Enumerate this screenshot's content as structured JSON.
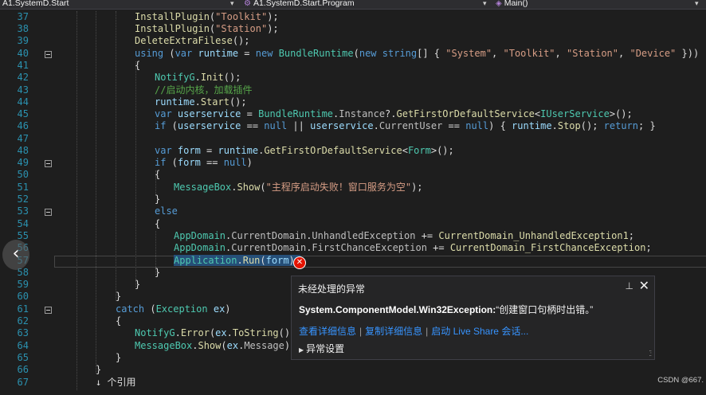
{
  "nav": {
    "project": "A1.SystemD.Start",
    "class": "A1.SystemD.Start.Program",
    "member": "Main()"
  },
  "gutter": [
    "37",
    "38",
    "39",
    "40",
    "41",
    "42",
    "43",
    "44",
    "45",
    "46",
    "47",
    "48",
    "49",
    "50",
    "51",
    "52",
    "53",
    "54",
    "55",
    "56",
    "57",
    "58",
    "59",
    "60",
    "61",
    "62",
    "63",
    "64",
    "65",
    "66",
    "67"
  ],
  "code": {
    "l37": [
      [
        "mt",
        "InstallPlugin"
      ],
      [
        "pl",
        "("
      ],
      [
        "st",
        "\"Toolkit\""
      ],
      [
        "pl",
        ");"
      ]
    ],
    "l38": [
      [
        "mt",
        "InstallPlugin"
      ],
      [
        "pl",
        "("
      ],
      [
        "st",
        "\"Station\""
      ],
      [
        "pl",
        ");"
      ]
    ],
    "l39": [
      [
        "mt",
        "DeleteExtraFilese"
      ],
      [
        "pl",
        "();"
      ]
    ],
    "l40": [
      [
        "kw",
        "using"
      ],
      [
        "pl",
        " ("
      ],
      [
        "kw",
        "var"
      ],
      [
        "pl",
        " "
      ],
      [
        "id",
        "runtime"
      ],
      [
        "pl",
        " = "
      ],
      [
        "kw",
        "new"
      ],
      [
        "pl",
        " "
      ],
      [
        "ty",
        "BundleRuntime"
      ],
      [
        "pl",
        "("
      ],
      [
        "kw",
        "new"
      ],
      [
        "pl",
        " "
      ],
      [
        "kw",
        "string"
      ],
      [
        "pl",
        "[] { "
      ],
      [
        "st",
        "\"System\""
      ],
      [
        "pl",
        ", "
      ],
      [
        "st",
        "\"Toolkit\""
      ],
      [
        "pl",
        ", "
      ],
      [
        "st",
        "\"Station\""
      ],
      [
        "pl",
        ", "
      ],
      [
        "st",
        "\"Device\""
      ],
      [
        "pl",
        " }))"
      ]
    ],
    "l41": [
      [
        "pl",
        "{"
      ]
    ],
    "l42": [
      [
        "ty",
        "NotifyG"
      ],
      [
        "pl",
        "."
      ],
      [
        "mt",
        "Init"
      ],
      [
        "pl",
        "();"
      ]
    ],
    "l43": [
      [
        "cm",
        "//启动内核，加载插件"
      ]
    ],
    "l44": [
      [
        "id",
        "runtime"
      ],
      [
        "pl",
        "."
      ],
      [
        "mt",
        "Start"
      ],
      [
        "pl",
        "();"
      ]
    ],
    "l45": [
      [
        "kw",
        "var"
      ],
      [
        "pl",
        " "
      ],
      [
        "id",
        "userservice"
      ],
      [
        "pl",
        " = "
      ],
      [
        "ty",
        "BundleRuntime"
      ],
      [
        "pl",
        "."
      ],
      [
        "fn",
        "Instance"
      ],
      [
        "pl",
        "?."
      ],
      [
        "mt",
        "GetFirstOrDefaultService"
      ],
      [
        "pl",
        "<"
      ],
      [
        "ty",
        "IUserService"
      ],
      [
        "pl",
        ">();"
      ]
    ],
    "l46": [
      [
        "kw",
        "if"
      ],
      [
        "pl",
        " ("
      ],
      [
        "id",
        "userservice"
      ],
      [
        "pl",
        " == "
      ],
      [
        "kw",
        "null"
      ],
      [
        "pl",
        " || "
      ],
      [
        "id",
        "userservice"
      ],
      [
        "pl",
        "."
      ],
      [
        "fn",
        "CurrentUser"
      ],
      [
        "pl",
        " == "
      ],
      [
        "kw",
        "null"
      ],
      [
        "pl",
        ") { "
      ],
      [
        "id",
        "runtime"
      ],
      [
        "pl",
        "."
      ],
      [
        "mt",
        "Stop"
      ],
      [
        "pl",
        "(); "
      ],
      [
        "kw",
        "return"
      ],
      [
        "pl",
        "; }"
      ]
    ],
    "l47": [],
    "l48": [
      [
        "kw",
        "var"
      ],
      [
        "pl",
        " "
      ],
      [
        "id",
        "form"
      ],
      [
        "pl",
        " = "
      ],
      [
        "id",
        "runtime"
      ],
      [
        "pl",
        "."
      ],
      [
        "mt",
        "GetFirstOrDefaultService"
      ],
      [
        "pl",
        "<"
      ],
      [
        "ty",
        "Form"
      ],
      [
        "pl",
        ">();"
      ]
    ],
    "l49": [
      [
        "kw",
        "if"
      ],
      [
        "pl",
        " ("
      ],
      [
        "id",
        "form"
      ],
      [
        "pl",
        " == "
      ],
      [
        "kw",
        "null"
      ],
      [
        "pl",
        ")"
      ]
    ],
    "l50": [
      [
        "pl",
        "{"
      ]
    ],
    "l51": [
      [
        "ty",
        "MessageBox"
      ],
      [
        "pl",
        "."
      ],
      [
        "mt",
        "Show"
      ],
      [
        "pl",
        "("
      ],
      [
        "st",
        "\"主程序启动失败！窗口服务为空\""
      ],
      [
        "pl",
        ");"
      ]
    ],
    "l52": [
      [
        "pl",
        "}"
      ]
    ],
    "l53": [
      [
        "kw",
        "else"
      ]
    ],
    "l54": [
      [
        "pl",
        "{"
      ]
    ],
    "l55": [
      [
        "ty",
        "AppDomain"
      ],
      [
        "pl",
        "."
      ],
      [
        "fn",
        "CurrentDomain"
      ],
      [
        "pl",
        "."
      ],
      [
        "fn",
        "UnhandledException"
      ],
      [
        "pl",
        " += "
      ],
      [
        "mt",
        "CurrentDomain_UnhandledException1"
      ],
      [
        "pl",
        ";"
      ]
    ],
    "l56": [
      [
        "ty",
        "AppDomain"
      ],
      [
        "pl",
        "."
      ],
      [
        "fn",
        "CurrentDomain"
      ],
      [
        "pl",
        "."
      ],
      [
        "fn",
        "FirstChanceException"
      ],
      [
        "pl",
        " += "
      ],
      [
        "mt",
        "CurrentDomain_FirstChanceException"
      ],
      [
        "pl",
        ";"
      ]
    ],
    "l57a": "Application",
    "l57b": [
      [
        "pl",
        "."
      ],
      [
        "mt",
        "Run"
      ],
      [
        "pl",
        "("
      ],
      [
        "id",
        "form"
      ],
      [
        "pl",
        ");"
      ]
    ],
    "l58": [
      [
        "pl",
        "}"
      ]
    ],
    "l59": [
      [
        "pl",
        "}"
      ]
    ],
    "l60": [
      [
        "pl",
        "}"
      ]
    ],
    "l61": [
      [
        "kw",
        "catch"
      ],
      [
        "pl",
        " ("
      ],
      [
        "ty",
        "Exception"
      ],
      [
        "pl",
        " "
      ],
      [
        "id",
        "ex"
      ],
      [
        "pl",
        ")"
      ]
    ],
    "l62": [
      [
        "pl",
        "{"
      ]
    ],
    "l63": [
      [
        "ty",
        "NotifyG"
      ],
      [
        "pl",
        "."
      ],
      [
        "mt",
        "Error"
      ],
      [
        "pl",
        "("
      ],
      [
        "id",
        "ex"
      ],
      [
        "pl",
        "."
      ],
      [
        "mt",
        "ToString"
      ],
      [
        "pl",
        "());"
      ]
    ],
    "l64": [
      [
        "ty",
        "MessageBox"
      ],
      [
        "pl",
        "."
      ],
      [
        "mt",
        "Show"
      ],
      [
        "pl",
        "("
      ],
      [
        "id",
        "ex"
      ],
      [
        "pl",
        "."
      ],
      [
        "fn",
        "Message"
      ],
      [
        "pl",
        ");"
      ]
    ],
    "l65": [
      [
        "pl",
        "}"
      ]
    ],
    "l66": [
      [
        "pl",
        "}"
      ]
    ],
    "l67": [
      [
        "pl",
        "↓ 个引用"
      ]
    ]
  },
  "exception_popup": {
    "title": "未经处理的异常",
    "exception_type": "System.ComponentModel.Win32Exception:",
    "exception_message": "“创建窗口句柄时出错。”",
    "link_details": "查看详细信息",
    "link_copy": "复制详细信息",
    "link_liveshare": "启动 Live Share 会话...",
    "settings_label": "异常设置"
  },
  "watermark": "CSDN @667.",
  "colors": {
    "background": "#1e1e1e",
    "keyword": "#569cd6",
    "type": "#4ec9b0",
    "string": "#d69d85",
    "comment": "#57a64a",
    "method": "#dcdcaa",
    "link": "#3794ff",
    "error": "#e51400"
  }
}
